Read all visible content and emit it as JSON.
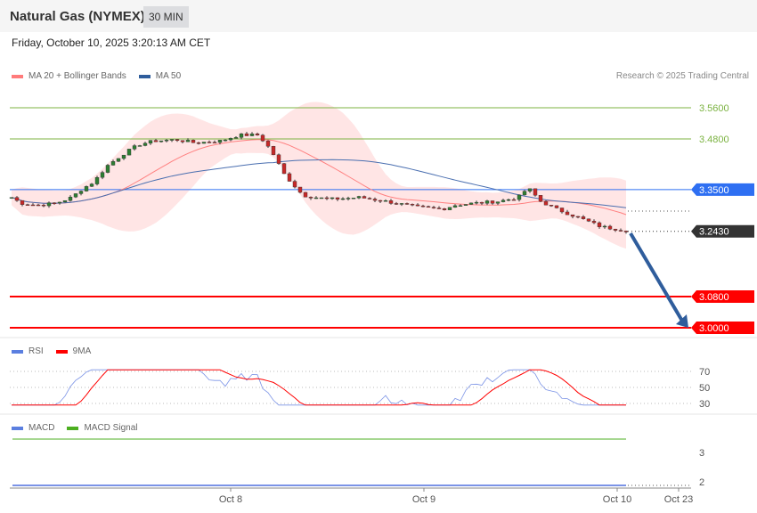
{
  "header": {
    "title": "Natural Gas (NYMEX)",
    "timeframe": "30 MIN",
    "date": "Friday, October 10, 2025 3:20:13 AM CET"
  },
  "legend": {
    "main": [
      "MA 20 + Bollinger Bands",
      "MA 50"
    ],
    "rsi": [
      "RSI",
      "9MA"
    ],
    "macd": [
      "MACD",
      "MACD Signal"
    ],
    "credit": "Research © 2025 Trading Central"
  },
  "colors": {
    "ma20": "#ff7b7b",
    "ma50": "#3a64a8",
    "band": "#ffe0e0",
    "resist": "#7cb342",
    "pivot": "#2e6ff2",
    "support": "#ff0000",
    "last": "#333333",
    "arrow": "#2f5d9c"
  },
  "chart_data": {
    "type": "candlestick",
    "levels": [
      {
        "value": "3.5600",
        "kind": "resistance"
      },
      {
        "value": "3.4800",
        "kind": "resistance"
      },
      {
        "value": "3.3500",
        "kind": "pivot"
      },
      {
        "value": "3.2430",
        "kind": "last"
      },
      {
        "value": "3.0800",
        "kind": "support"
      },
      {
        "value": "3.0000",
        "kind": "support"
      }
    ],
    "price_keypoints": [
      [
        0,
        3.33
      ],
      [
        3,
        3.315
      ],
      [
        8,
        3.31
      ],
      [
        14,
        3.315
      ],
      [
        19,
        3.33
      ],
      [
        22,
        3.35
      ],
      [
        26,
        3.37
      ],
      [
        30,
        3.41
      ],
      [
        35,
        3.44
      ],
      [
        40,
        3.465
      ],
      [
        45,
        3.475
      ],
      [
        52,
        3.478
      ],
      [
        58,
        3.47
      ],
      [
        66,
        3.475
      ],
      [
        72,
        3.49
      ],
      [
        78,
        3.49
      ],
      [
        82,
        3.45
      ],
      [
        86,
        3.39
      ],
      [
        92,
        3.335
      ],
      [
        100,
        3.325
      ],
      [
        110,
        3.33
      ],
      [
        118,
        3.32
      ],
      [
        128,
        3.305
      ],
      [
        136,
        3.3
      ],
      [
        140,
        3.31
      ],
      [
        146,
        3.315
      ],
      [
        154,
        3.32
      ],
      [
        160,
        3.33
      ],
      [
        163,
        3.355
      ],
      [
        167,
        3.32
      ],
      [
        172,
        3.3
      ],
      [
        180,
        3.275
      ],
      [
        186,
        3.255
      ],
      [
        194,
        3.245
      ]
    ],
    "x_ticks": [
      "Oct 8",
      "Oct 9",
      "Oct 10",
      "Oct 23"
    ],
    "rsi_ticks": [
      "70",
      "50",
      "30"
    ],
    "macd_ticks": [
      "3",
      "2"
    ]
  }
}
